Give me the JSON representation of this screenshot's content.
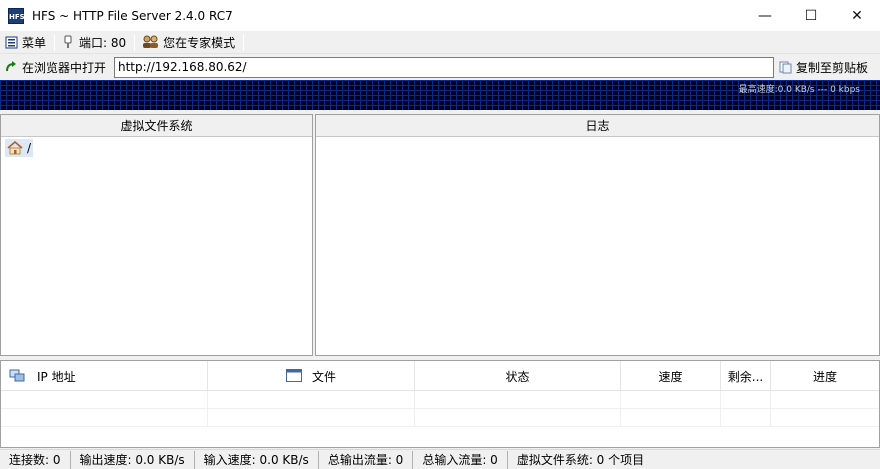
{
  "window": {
    "title": "HFS ~ HTTP File Server 2.4.0 RC7",
    "app_icon_text": "HFS",
    "minimize": "—",
    "maximize": "☐",
    "close": "✕"
  },
  "toolbar": {
    "menu_label": "菜单",
    "port_label": "端口: 80",
    "mode_label": "您在专家模式"
  },
  "urlbar": {
    "open_label": "在浏览器中打开",
    "url": "http://192.168.80.62/",
    "copy_label": "复制至剪贴板"
  },
  "graph": {
    "speed_text": "最高速度:0.0 KB/s  ---  0 kbps"
  },
  "vfs": {
    "header": "虚拟文件系统",
    "root": "/"
  },
  "log": {
    "header": "日志"
  },
  "connections": {
    "columns": [
      "IP 地址",
      "文件",
      "状态",
      "速度",
      "剩余...",
      "进度"
    ]
  },
  "status": {
    "items": [
      "连接数: 0",
      "输出速度: 0.0 KB/s",
      "输入速度: 0.0 KB/s",
      "总输出流量: 0",
      "总输入流量: 0",
      "虚拟文件系统: 0 个项目"
    ]
  },
  "colors": {
    "graph_bg": "#000020",
    "graph_grid": "#0a2a8a",
    "selection": "#dde8f6"
  }
}
